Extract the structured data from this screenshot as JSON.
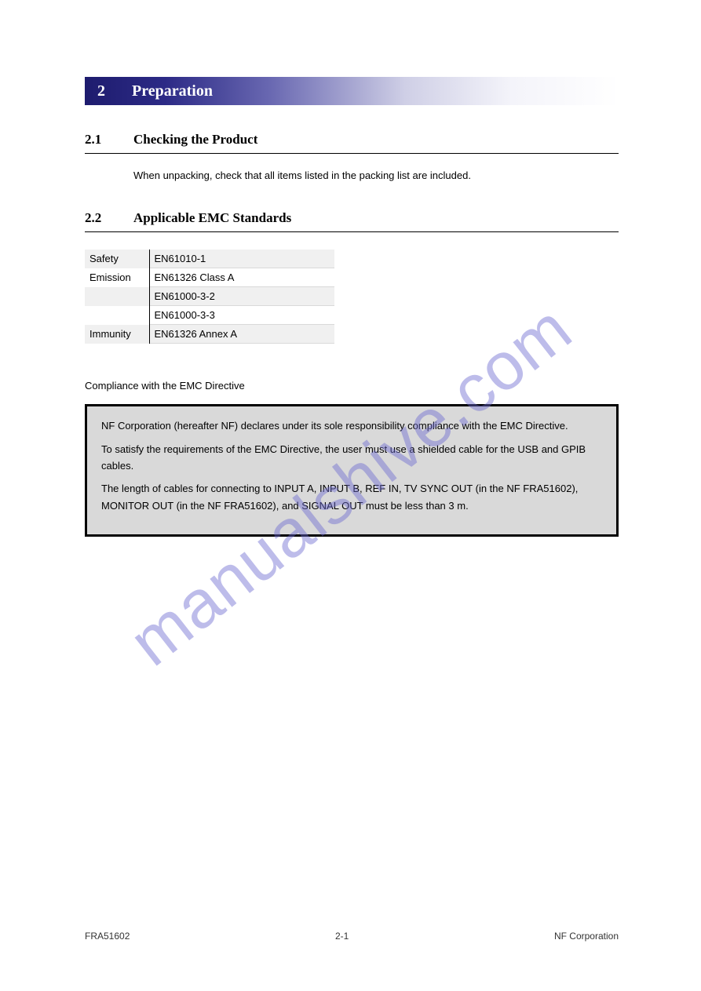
{
  "banner": {
    "number": "2",
    "title": "Preparation"
  },
  "s21": {
    "num": "2.1",
    "title": "Checking the Product",
    "body": "When unpacking, check that all items listed in the packing list are included."
  },
  "s22": {
    "num": "2.2",
    "title": "Applicable EMC Standards",
    "rows": [
      {
        "k": "Safety",
        "v": "EN61010-1"
      },
      {
        "k": "Emission",
        "v": "EN61326 Class A"
      },
      {
        "k": "",
        "v": "EN61000-3-2"
      },
      {
        "k": "",
        "v": "EN61000-3-3"
      },
      {
        "k": "Immunity",
        "v": "EN61326 Annex A"
      }
    ],
    "compliance_lead": "Compliance with the EMC Directive",
    "box": {
      "p1": "NF Corporation (hereafter NF) declares under its sole responsibility compliance with the EMC Directive.",
      "p2": "To satisfy the requirements of the EMC Directive, the user must use a shielded cable for the USB and GPIB cables.",
      "p3": "The length of cables for connecting to INPUT A, INPUT B, REF IN, TV SYNC OUT (in the NF FRA51602), MONITOR OUT (in the NF FRA51602), and SIGNAL OUT must be less than 3 m."
    }
  },
  "footer": {
    "left": "FRA51602",
    "center": "2-1",
    "right": "NF Corporation"
  },
  "watermark": "manualshive.com"
}
